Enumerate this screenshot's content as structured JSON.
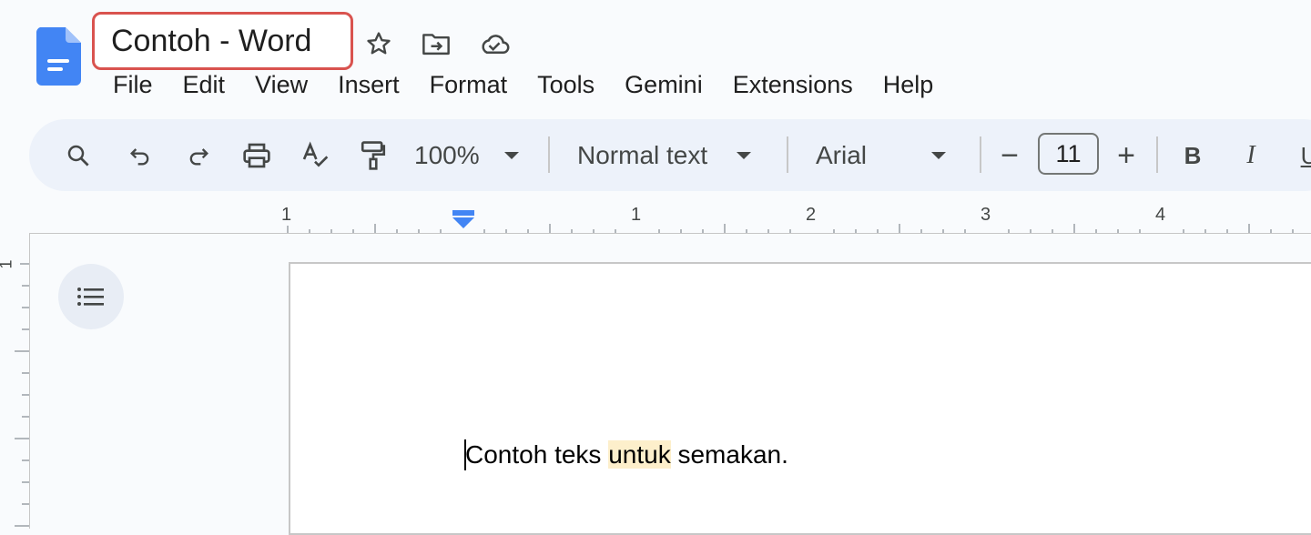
{
  "document": {
    "title": "Contoh - Word"
  },
  "menu": {
    "items": [
      "File",
      "Edit",
      "View",
      "Insert",
      "Format",
      "Tools",
      "Gemini",
      "Extensions",
      "Help"
    ]
  },
  "toolbar": {
    "zoom": "100%",
    "style": "Normal text",
    "font": "Arial",
    "font_size": "11",
    "decrease_label": "−",
    "increase_label": "+",
    "bold_label": "B",
    "italic_label": "I",
    "underline_label": "U"
  },
  "ruler": {
    "labels": [
      "1",
      "1",
      "2",
      "3",
      "4"
    ]
  },
  "vruler": {
    "label": "1"
  },
  "body": {
    "text_before": "Contoh teks ",
    "text_highlight": "untuk",
    "text_after": " semakan."
  },
  "colors": {
    "accent": "#4285f4",
    "title_highlight_border": "#d9534f",
    "text_highlight": "#fdefcb"
  },
  "icons": {
    "app": "google-docs-icon",
    "star": "star-icon",
    "move": "move-to-folder-icon",
    "cloud": "cloud-saved-icon",
    "outline": "document-outline-icon"
  }
}
